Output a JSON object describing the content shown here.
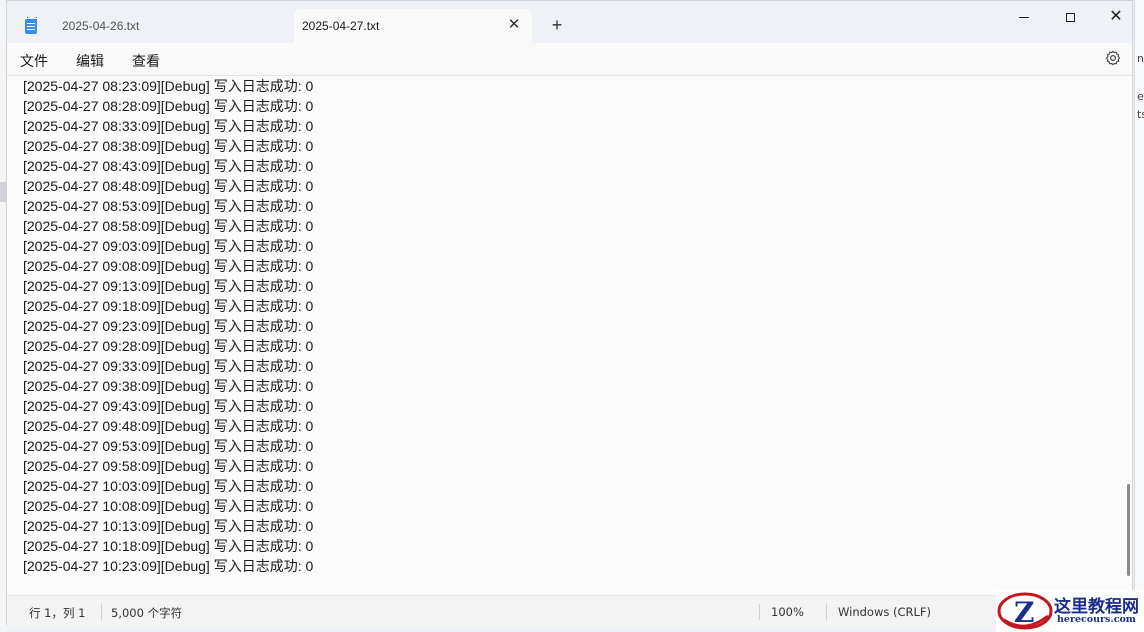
{
  "tabs": [
    {
      "label": "2025-04-26.txt",
      "active": false
    },
    {
      "label": "2025-04-27.txt",
      "active": true
    }
  ],
  "tab_close_glyph": "✕",
  "new_tab_glyph": "+",
  "window_controls": {
    "close_glyph": "✕"
  },
  "menu": {
    "file": "文件",
    "edit": "编辑",
    "view": "查看"
  },
  "settings_icon": "gear-icon",
  "editor": {
    "lines": [
      "[2025-04-27 08:23:09][Debug] 写入日志成功: 0",
      "[2025-04-27 08:28:09][Debug] 写入日志成功: 0",
      "[2025-04-27 08:33:09][Debug] 写入日志成功: 0",
      "[2025-04-27 08:38:09][Debug] 写入日志成功: 0",
      "[2025-04-27 08:43:09][Debug] 写入日志成功: 0",
      "[2025-04-27 08:48:09][Debug] 写入日志成功: 0",
      "[2025-04-27 08:53:09][Debug] 写入日志成功: 0",
      "[2025-04-27 08:58:09][Debug] 写入日志成功: 0",
      "[2025-04-27 09:03:09][Debug] 写入日志成功: 0",
      "[2025-04-27 09:08:09][Debug] 写入日志成功: 0",
      "[2025-04-27 09:13:09][Debug] 写入日志成功: 0",
      "[2025-04-27 09:18:09][Debug] 写入日志成功: 0",
      "[2025-04-27 09:23:09][Debug] 写入日志成功: 0",
      "[2025-04-27 09:28:09][Debug] 写入日志成功: 0",
      "[2025-04-27 09:33:09][Debug] 写入日志成功: 0",
      "[2025-04-27 09:38:09][Debug] 写入日志成功: 0",
      "[2025-04-27 09:43:09][Debug] 写入日志成功: 0",
      "[2025-04-27 09:48:09][Debug] 写入日志成功: 0",
      "[2025-04-27 09:53:09][Debug] 写入日志成功: 0",
      "[2025-04-27 09:58:09][Debug] 写入日志成功: 0",
      "[2025-04-27 10:03:09][Debug] 写入日志成功: 0",
      "[2025-04-27 10:08:09][Debug] 写入日志成功: 0",
      "[2025-04-27 10:13:09][Debug] 写入日志成功: 0",
      "[2025-04-27 10:18:09][Debug] 写入日志成功: 0",
      "[2025-04-27 10:23:09][Debug] 写入日志成功: 0"
    ]
  },
  "status": {
    "position": "行 1，列 1",
    "char_count": "5,000 个字符",
    "zoom": "100%",
    "line_ending": "Windows (CRLF)"
  },
  "watermark": {
    "name": "这里教程网",
    "url": "herecours.com",
    "letter": "Z"
  },
  "background_fragments": [
    "nf",
    "er",
    "ts"
  ]
}
